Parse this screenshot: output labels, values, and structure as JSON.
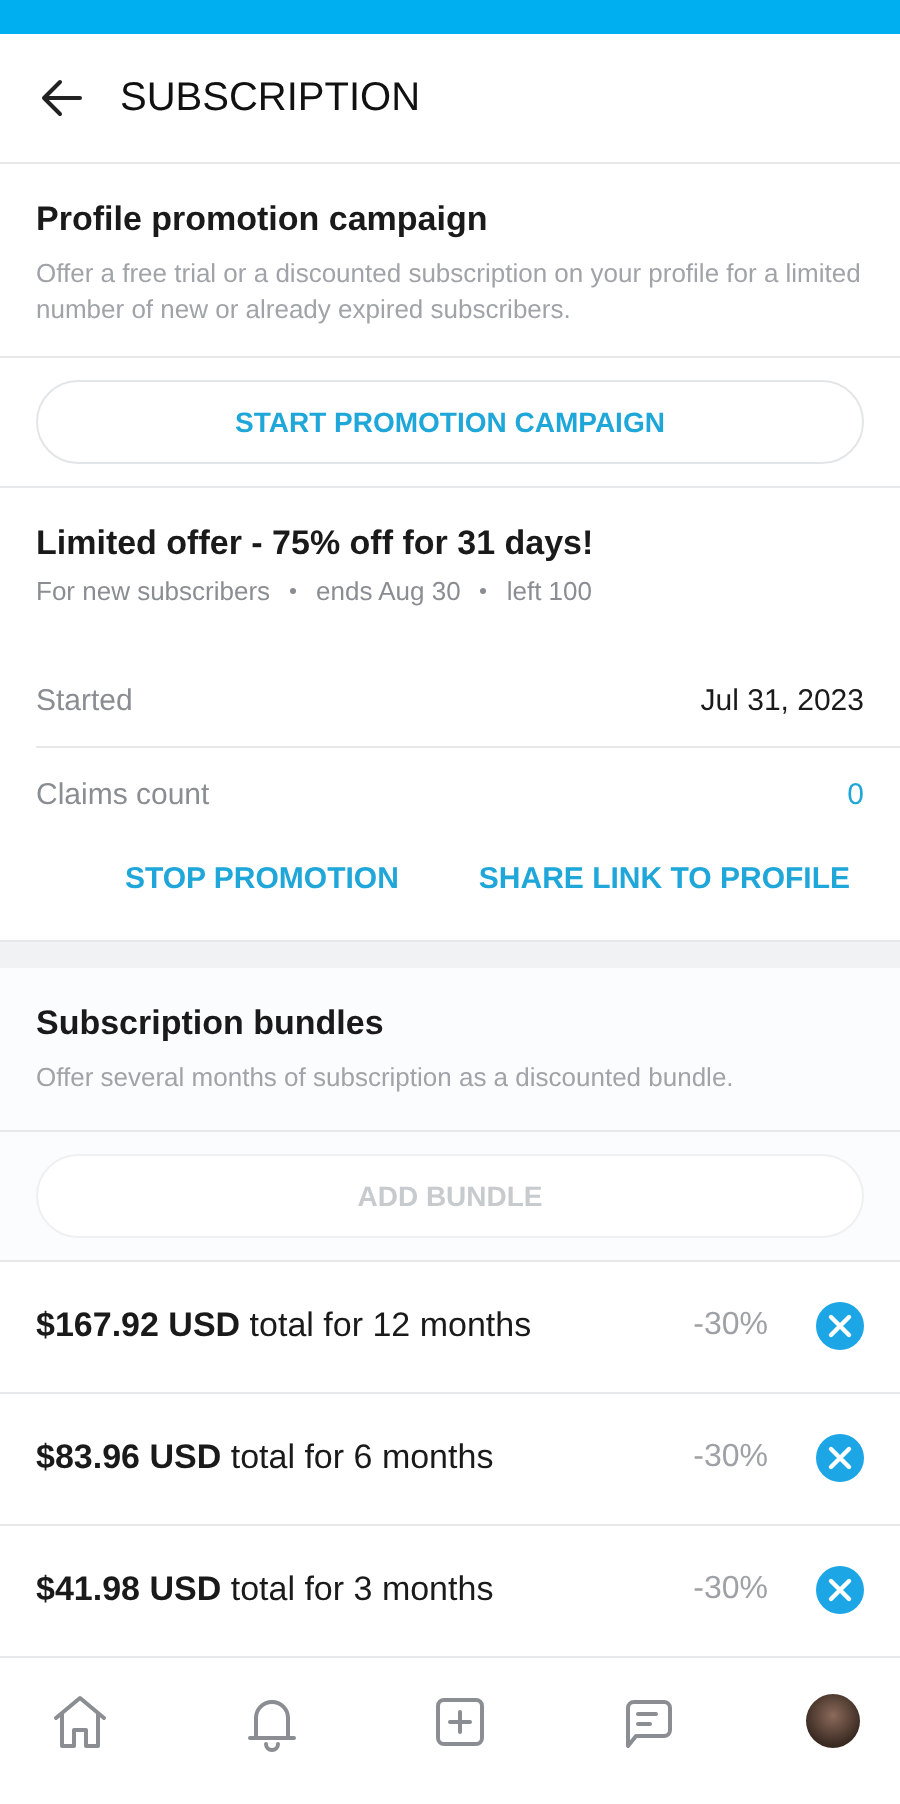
{
  "header": {
    "title": "SUBSCRIPTION"
  },
  "promotion": {
    "title": "Profile promotion campaign",
    "description": "Offer a free trial or a discounted subscription on your profile for a limited number of new or already expired subscribers.",
    "button": "START PROMOTION CAMPAIGN"
  },
  "offer": {
    "title": "Limited offer - 75% off for 31 days!",
    "meta": [
      "For new subscribers",
      "ends Aug 30",
      "left 100"
    ],
    "details": [
      {
        "label": "Started",
        "value": "Jul 31, 2023",
        "kind": "plain"
      },
      {
        "label": "Claims count",
        "value": "0",
        "kind": "link"
      }
    ],
    "actions": [
      "STOP PROMOTION",
      "SHARE LINK TO PROFILE"
    ]
  },
  "bundles": {
    "title": "Subscription bundles",
    "description": "Offer several months of subscription as a discounted bundle.",
    "add_button": {
      "label": "ADD BUNDLE",
      "disabled": true
    },
    "items": [
      {
        "text": "**$167.92 USD** total for 12 months",
        "discount": "-30%"
      },
      {
        "text": "**$83.96 USD** total for 6 months",
        "discount": "-30%"
      },
      {
        "text": "**$41.98 USD** total for 3 months",
        "discount": "-30%"
      }
    ]
  },
  "nav": [
    {
      "kind": "home"
    },
    {
      "kind": "bell"
    },
    {
      "kind": "add"
    },
    {
      "kind": "messages"
    },
    {
      "kind": "avatar"
    }
  ]
}
